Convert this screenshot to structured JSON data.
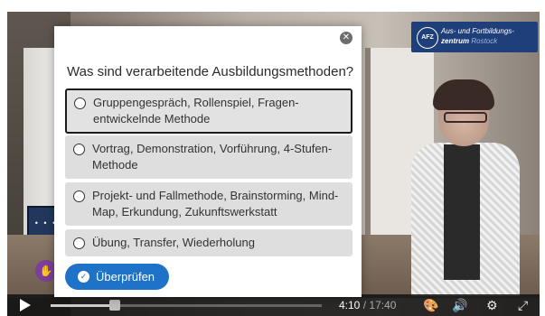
{
  "logo": {
    "badge": "AFZ",
    "line1": "Aus- und Fortbildungs-",
    "line2_bold": "zentrum",
    "line2_rest": "Rostock"
  },
  "quiz": {
    "question": "Was sind verarbeitende Ausbildungsmethoden?",
    "options": [
      {
        "label": "Gruppengespräch, Rollenspiel, Fragen-entwickelnde Methode",
        "selected": true
      },
      {
        "label": "Vortrag, Demonstration, Vorführung, 4-Stufen-Methode",
        "selected": false
      },
      {
        "label": "Projekt- und Fallmethode, Brainstorming, Mind-Map, Erkundung, Zukunftswerkstatt",
        "selected": false
      },
      {
        "label": "Übung, Transfer, Wiederholung",
        "selected": false
      }
    ],
    "check_label": "Überprüfen"
  },
  "player": {
    "current_time": "4:10",
    "separator": "/",
    "duration": "17:40",
    "progress_fraction": 0.236,
    "icons": [
      "play-icon",
      "hand-icon",
      "palette-icon",
      "volume-icon",
      "gear-icon",
      "fullscreen-icon",
      "close-icon",
      "check-circle-icon"
    ]
  }
}
